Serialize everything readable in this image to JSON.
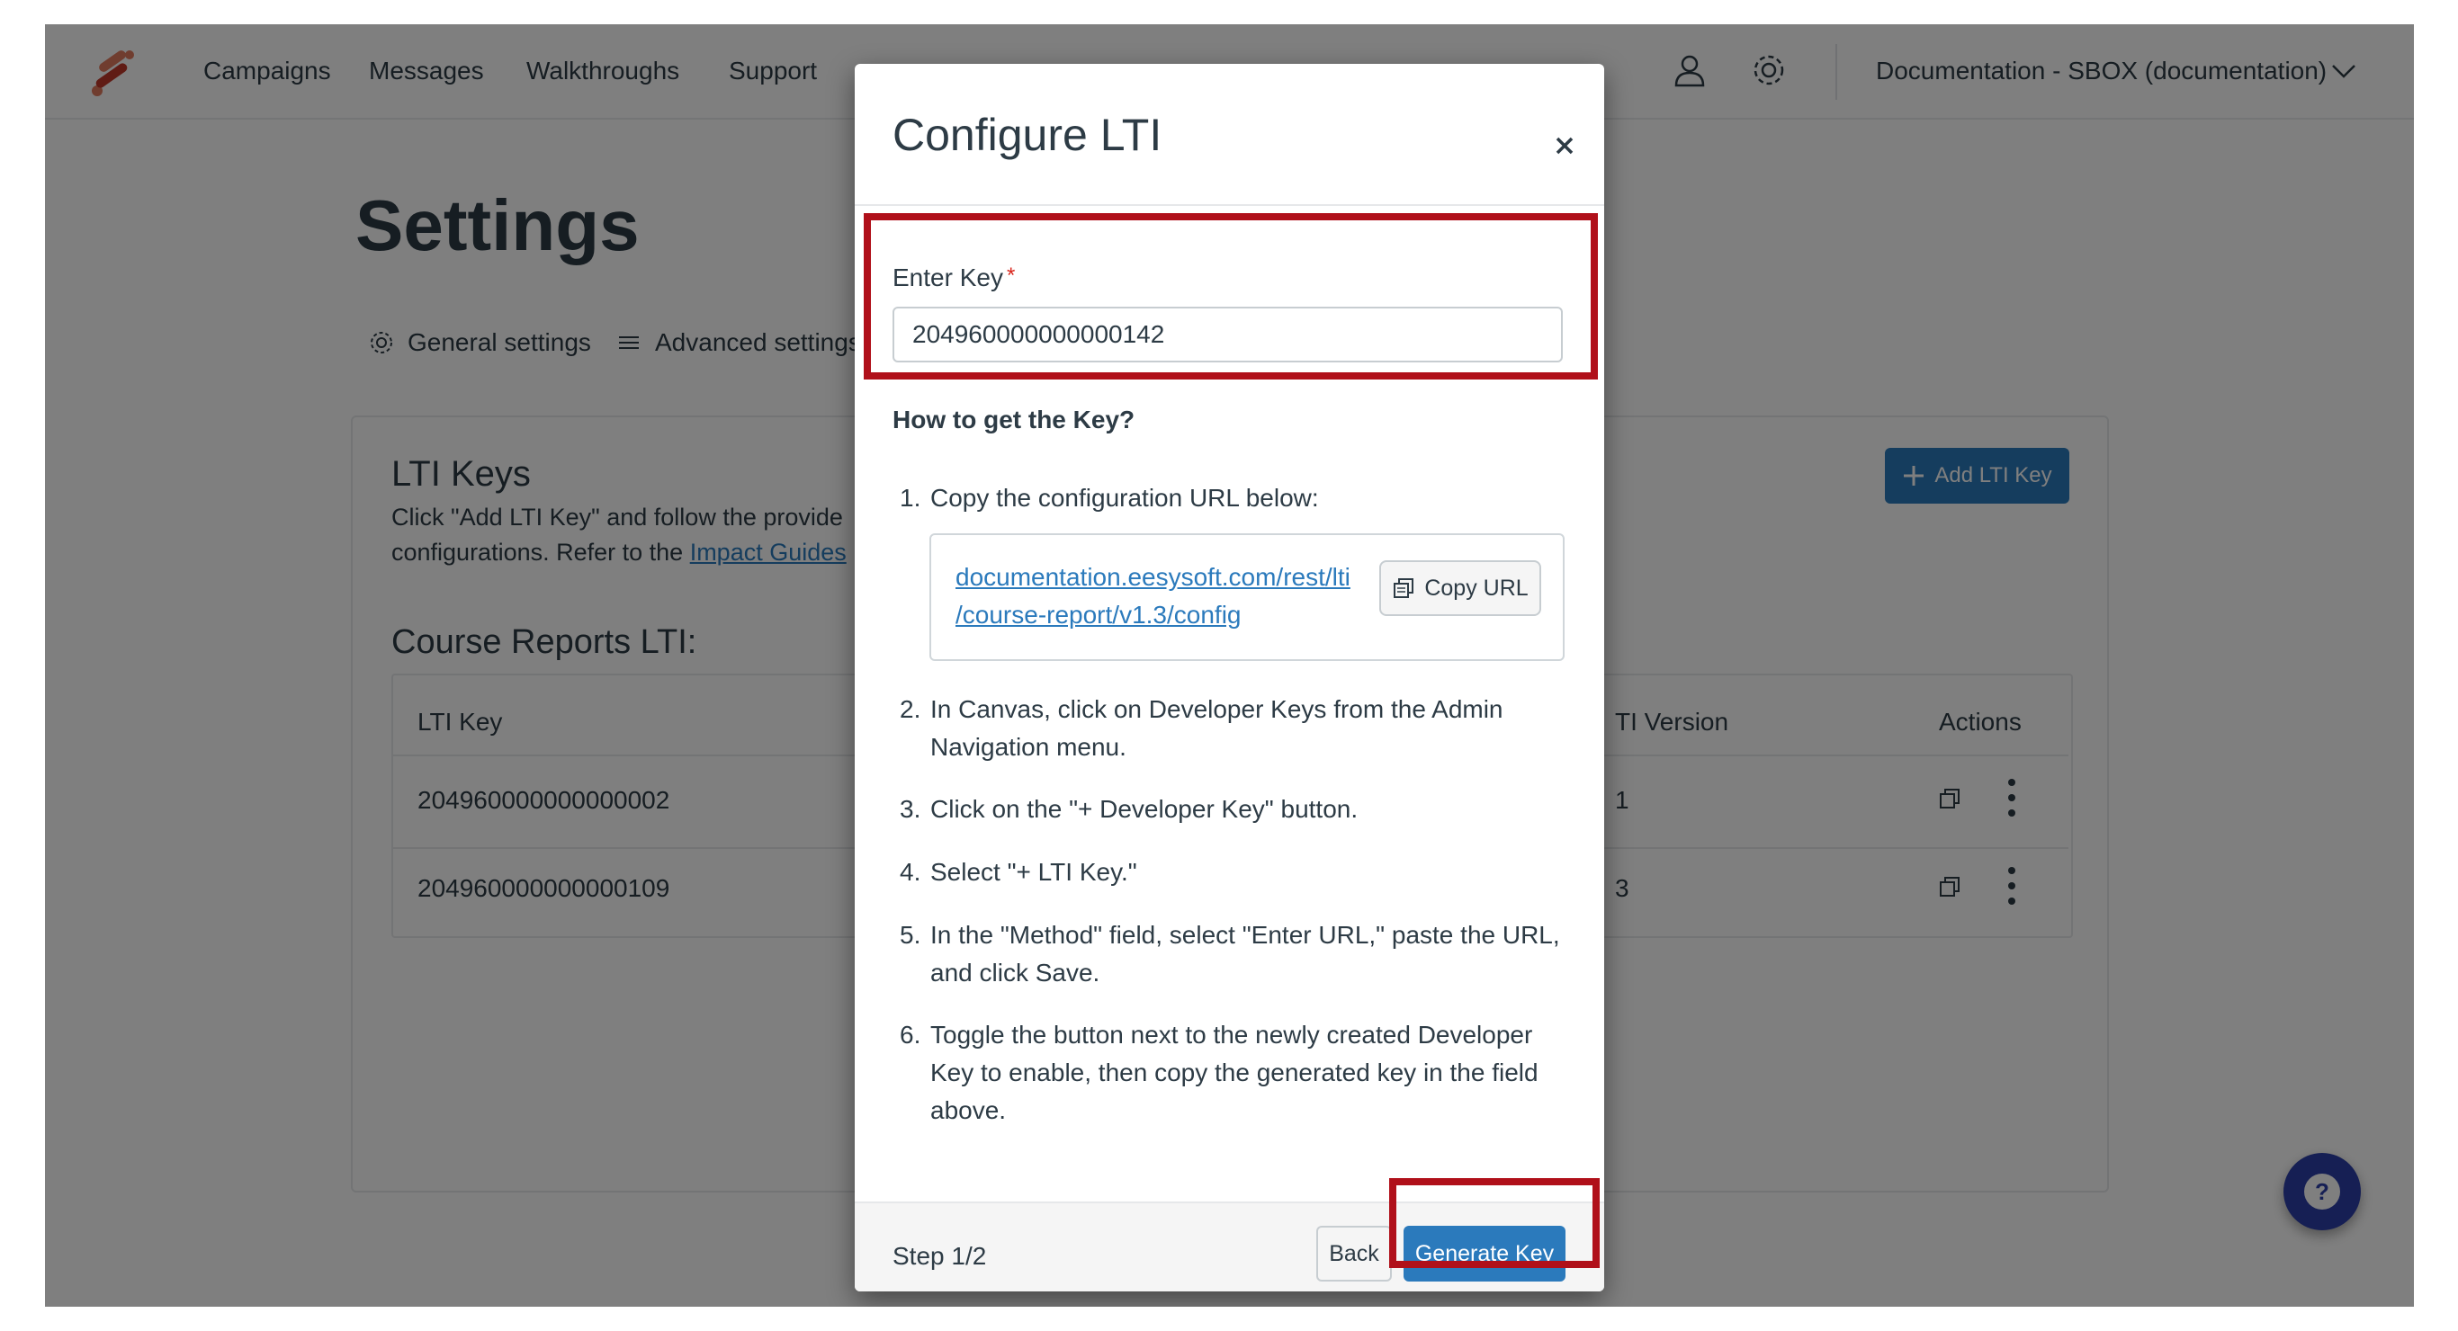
{
  "nav": {
    "links": [
      "Campaigns",
      "Messages",
      "Walkthroughs",
      "Support"
    ],
    "account": "Documentation - SBOX (documentation)"
  },
  "settings": {
    "title": "Settings",
    "tabs": [
      "General settings",
      "Advanced settings"
    ],
    "card_title": "LTI Keys",
    "card_desc_line1": "Click \"Add LTI Key\" and follow the provide",
    "card_desc_line2_prefix": "configurations. Refer to the ",
    "card_desc_link": "Impact Guides",
    "section_title": "Course Reports LTI:",
    "add_button": "Add LTI Key",
    "table": {
      "headers": [
        "LTI Key",
        "TI Version",
        "Actions"
      ],
      "rows": [
        {
          "key": "204960000000000002",
          "version": "1"
        },
        {
          "key": "204960000000000109",
          "version": "3"
        }
      ]
    }
  },
  "modal": {
    "title": "Configure LTI",
    "field_label": "Enter Key",
    "required_mark": "*",
    "key_value": "204960000000000142",
    "howto_heading": "How to get the Key?",
    "steps": [
      {
        "num": "1.",
        "text": "Copy the configuration URL below:"
      },
      {
        "num": "2.",
        "text": "In Canvas, click on Developer Keys from the Admin Navigation menu."
      },
      {
        "num": "3.",
        "text": "Click on the \"+ Developer Key\" button."
      },
      {
        "num": "4.",
        "text": "Select \"+ LTI Key.\""
      },
      {
        "num": "5.",
        "text": "In the \"Method\" field, select \"Enter URL,\" paste the URL, and click Save."
      },
      {
        "num": "6.",
        "text": "Toggle the button next to the newly created Developer Key to enable, then copy the generated key in the field above."
      }
    ],
    "config_url_line1": "documentation.eesysoft.com/rest/lti",
    "config_url_line2": "/course-report/v1.3/config",
    "copy_button": "Copy URL",
    "step_indicator": "Step 1/2",
    "back_button": "Back",
    "generate_button": "Generate Key"
  },
  "colors": {
    "accent": "#2b7abc",
    "highlight": "#b0101a",
    "help_button": "#2d3fa8",
    "text": "#2d3b45"
  },
  "icons": [
    "logo-icon",
    "user-icon",
    "gear-icon",
    "chevron-down-icon",
    "close-icon",
    "copy-icon",
    "plus-icon",
    "help-icon",
    "kebab-icon"
  ]
}
